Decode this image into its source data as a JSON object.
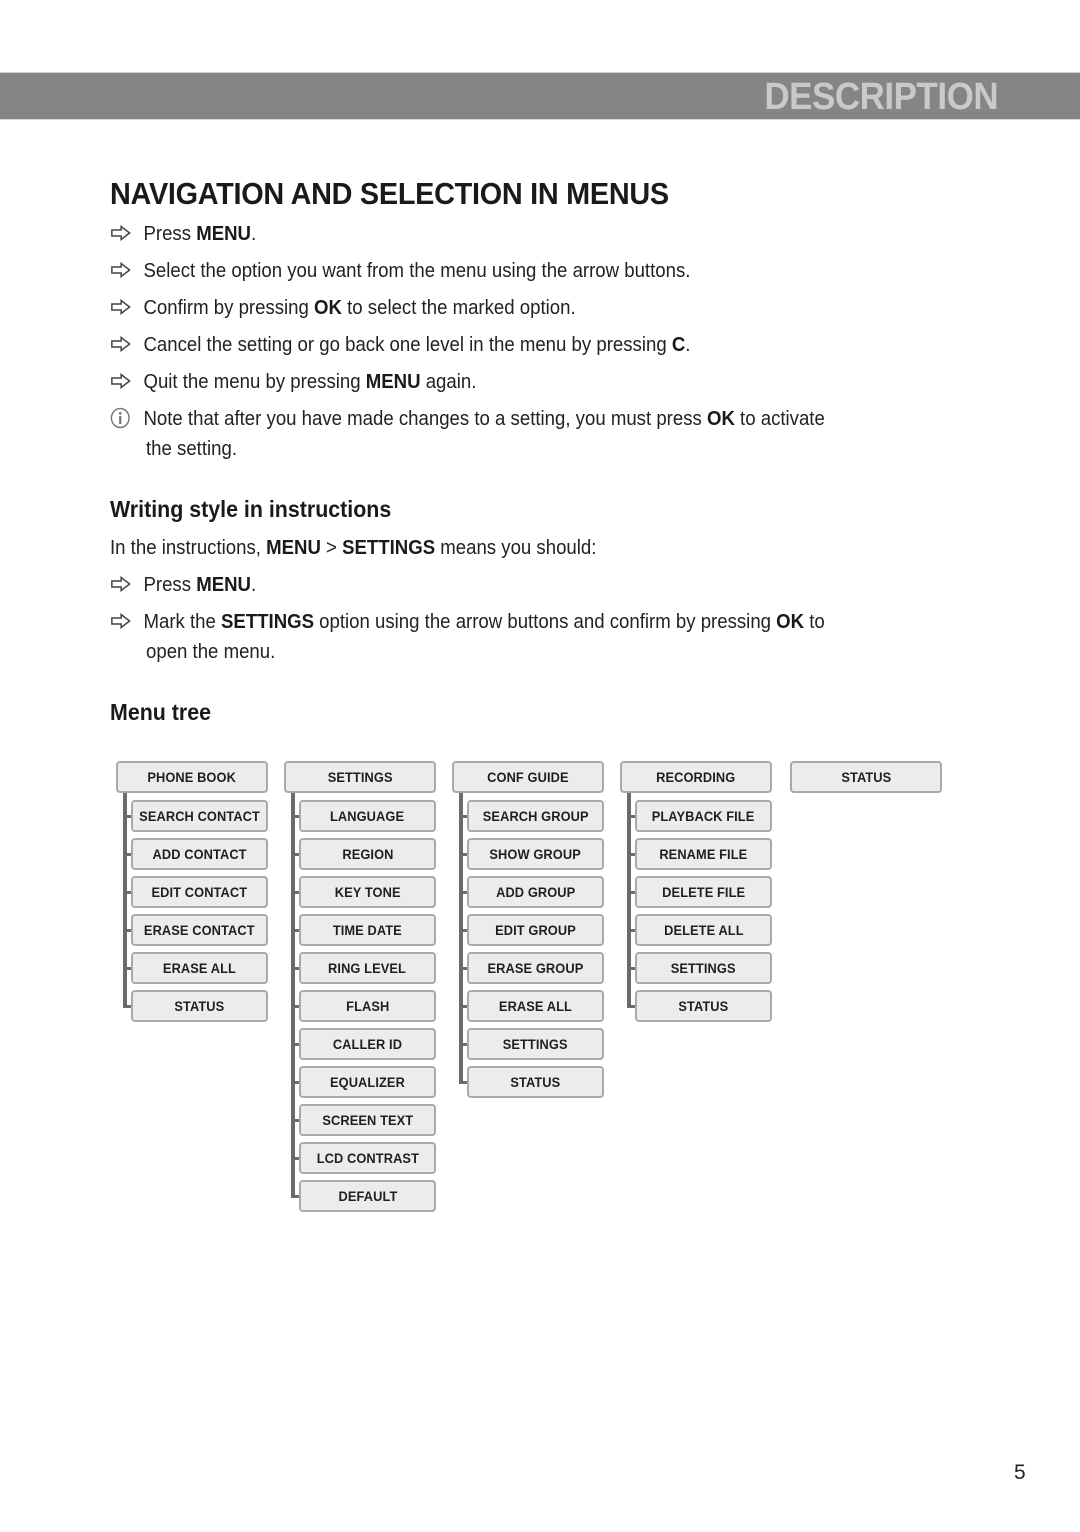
{
  "header": {
    "title": "DESCRIPTION",
    "bar_color": "#858585"
  },
  "page_title": "NAVIGATION AND SELECTION IN MENUS",
  "navigation_steps": [
    {
      "icon": "arrow-right-icon",
      "parts": [
        {
          "text": "Press "
        },
        {
          "text": "MENU",
          "bold": true
        },
        {
          "text": "."
        }
      ]
    },
    {
      "icon": "arrow-right-icon",
      "parts": [
        {
          "text": "Select the option you want from the menu using the arrow buttons."
        }
      ]
    },
    {
      "icon": "arrow-right-icon",
      "parts": [
        {
          "text": "Confirm by pressing "
        },
        {
          "text": "OK",
          "bold": true
        },
        {
          "text": " to select the marked option."
        }
      ]
    },
    {
      "icon": "arrow-right-icon",
      "parts": [
        {
          "text": "Cancel the setting or go back one level in the menu by pressing "
        },
        {
          "text": "C",
          "bold": true
        },
        {
          "text": "."
        }
      ]
    },
    {
      "icon": "arrow-right-icon",
      "parts": [
        {
          "text": "Quit the menu by pressing "
        },
        {
          "text": "MENU",
          "bold": true
        },
        {
          "text": " again."
        }
      ]
    }
  ],
  "note": {
    "icon": "info-icon",
    "line1_parts": [
      {
        "text": "Note that after you have made changes to a setting, you must press "
      },
      {
        "text": "OK",
        "bold": true
      },
      {
        "text": " to activate"
      }
    ],
    "line2": "the setting."
  },
  "writing_style": {
    "title": "Writing style in instructions",
    "intro_parts": [
      {
        "text": "In the instructions, "
      },
      {
        "text": "MENU",
        "bold": true
      },
      {
        "text": " > "
      },
      {
        "text": "SETTINGS",
        "bold": true
      },
      {
        "text": " means you should:"
      }
    ],
    "steps": [
      {
        "icon": "arrow-right-icon",
        "parts": [
          {
            "text": "Press "
          },
          {
            "text": "MENU",
            "bold": true
          },
          {
            "text": "."
          }
        ]
      },
      {
        "icon": "arrow-right-icon",
        "parts": [
          {
            "text": "Mark the "
          },
          {
            "text": "SETTINGS",
            "bold": true
          },
          {
            "text": " option using the arrow buttons and confirm by pressing "
          },
          {
            "text": "OK",
            "bold": true
          },
          {
            "text": " to"
          }
        ],
        "continuation": "open the menu."
      }
    ]
  },
  "menu_tree": {
    "title": "Menu tree",
    "columns": [
      {
        "root": "PHONE BOOK",
        "children": [
          "SEARCH CONTACT",
          "ADD CONTACT",
          "EDIT CONTACT",
          "ERASE CONTACT",
          "ERASE ALL",
          "STATUS"
        ]
      },
      {
        "root": "SETTINGS",
        "children": [
          "LANGUAGE",
          "REGION",
          "KEY TONE",
          "TIME DATE",
          "RING LEVEL",
          "FLASH",
          "CALLER ID",
          "EQUALIZER",
          "SCREEN TEXT",
          "LCD CONTRAST",
          "DEFAULT"
        ]
      },
      {
        "root": "CONF GUIDE",
        "children": [
          "SEARCH GROUP",
          "SHOW GROUP",
          "ADD GROUP",
          "EDIT GROUP",
          "ERASE GROUP",
          "ERASE ALL",
          "SETTINGS",
          "STATUS"
        ]
      },
      {
        "root": "RECORDING",
        "children": [
          "PLAYBACK FILE",
          "RENAME FILE",
          "DELETE FILE",
          "DELETE ALL",
          "SETTINGS",
          "STATUS"
        ]
      },
      {
        "root": "STATUS",
        "children": []
      }
    ]
  },
  "page_number": "5"
}
